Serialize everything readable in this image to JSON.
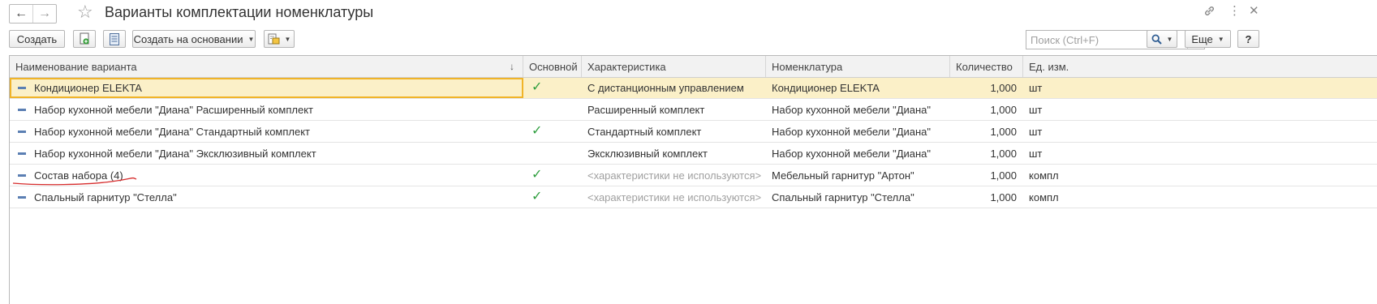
{
  "window": {
    "title": "Варианты комплектации номенклатуры",
    "back_icon": "arrow-left",
    "forward_icon": "arrow-right",
    "favorite_icon": "star-outline",
    "link_icon": "link",
    "more_icon": "vertical-ellipsis",
    "close_icon": "close"
  },
  "toolbar": {
    "create_label": "Создать",
    "create_based_label": "Создать на основании",
    "search_placeholder": "Поиск (Ctrl+F)",
    "search_value": "",
    "clear_label": "×",
    "more_label": "Еще",
    "help_label": "?"
  },
  "table": {
    "columns": [
      "Наименование варианта",
      "Основной",
      "Характеристика",
      "Номенклатура",
      "Количество",
      "Ед. изм."
    ],
    "sort_indicator": "↓",
    "rows": [
      {
        "name": "Кондиционер ELEKTA",
        "main": true,
        "characteristic": "С дистанционным управлением",
        "item": "Кондиционер ELEKTA",
        "qty": "1,000",
        "unit": "шт",
        "selected": true
      },
      {
        "name": "Набор кухонной мебели \"Диана\" Расширенный комплект",
        "main": false,
        "characteristic": "Расширенный комплект",
        "item": "Набор кухонной мебели \"Диана\"",
        "qty": "1,000",
        "unit": "шт"
      },
      {
        "name": "Набор кухонной мебели \"Диана\" Стандартный комплект",
        "main": true,
        "characteristic": "Стандартный комплект",
        "item": "Набор кухонной мебели \"Диана\"",
        "qty": "1,000",
        "unit": "шт"
      },
      {
        "name": "Набор кухонной мебели \"Диана\" Эксклюзивный комплект",
        "main": false,
        "characteristic": "Эксклюзивный комплект",
        "item": "Набор кухонной мебели \"Диана\"",
        "qty": "1,000",
        "unit": "шт"
      },
      {
        "name": "Состав набора (4)",
        "main": true,
        "characteristic": "<характеристики не используются>",
        "item": "Мебельный гарнитур \"Артон\"",
        "qty": "1,000",
        "unit": "компл",
        "char_muted": true,
        "underlined": true
      },
      {
        "name": "Спальный гарнитур \"Стелла\"",
        "main": true,
        "characteristic": "<характеристики не используются>",
        "item": "Спальный гарнитур \"Стелла\"",
        "qty": "1,000",
        "unit": "компл",
        "char_muted": true
      }
    ]
  },
  "colors": {
    "selected_row": "#fbf0c8",
    "focus_border": "#f0b429",
    "check": "#2e9e3e",
    "annotation": "#d62b2b"
  }
}
